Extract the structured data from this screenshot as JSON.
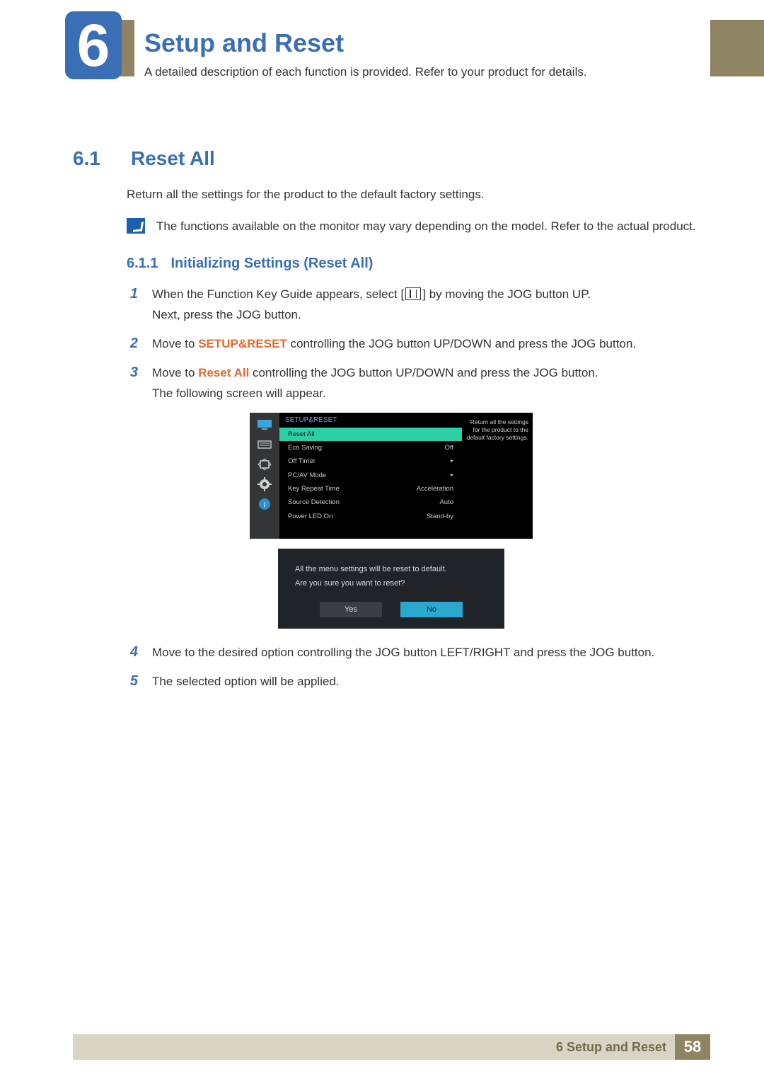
{
  "chapter": {
    "number": "6",
    "title": "Setup and Reset",
    "description": "A detailed description of each function is provided. Refer to your product for details."
  },
  "section": {
    "number": "6.1",
    "title": "Reset All",
    "intro": "Return all the settings for the product to the default factory settings.",
    "note": "The functions available on the monitor may vary depending on the model. Refer to the actual product."
  },
  "subsection": {
    "number": "6.1.1",
    "title": "Initializing Settings (Reset All)"
  },
  "steps": {
    "s1a": "When the Function Key Guide appears, select [",
    "s1b": "] by moving the JOG button UP.",
    "s1c": "Next, press the JOG button.",
    "s2a": "Move to ",
    "s2kw": "SETUP&RESET",
    "s2b": " controlling the JOG button UP/DOWN and press the JOG button.",
    "s3a": "Move to ",
    "s3kw": "Reset All",
    "s3b": " controlling the JOG button UP/DOWN and press the JOG button.",
    "s3c": "The following screen will appear.",
    "s4": "Move to the desired option controlling the JOG button LEFT/RIGHT and press the JOG button.",
    "s5": "The selected option will be applied."
  },
  "step_nums": {
    "n1": "1",
    "n2": "2",
    "n3": "3",
    "n4": "4",
    "n5": "5"
  },
  "osd": {
    "header": "SETUP&RESET",
    "info": "Return all the settings for the product to the default factory settings.",
    "items": [
      {
        "label": "Reset All",
        "value": "",
        "selected": true
      },
      {
        "label": "Eco Saving",
        "value": "Off"
      },
      {
        "label": "Off Timer",
        "value": "▸"
      },
      {
        "label": "PC/AV Mode",
        "value": "▸"
      },
      {
        "label": "Key Repeat Time",
        "value": "Acceleration"
      },
      {
        "label": "Source Detection",
        "value": "Auto"
      },
      {
        "label": "Power LED On",
        "value": "Stand-by"
      }
    ]
  },
  "dialog": {
    "line1": "All the menu settings will be reset to default.",
    "line2": "Are you sure you want to reset?",
    "yes": "Yes",
    "no": "No"
  },
  "footer": {
    "label": "6 Setup and Reset",
    "page": "58"
  }
}
